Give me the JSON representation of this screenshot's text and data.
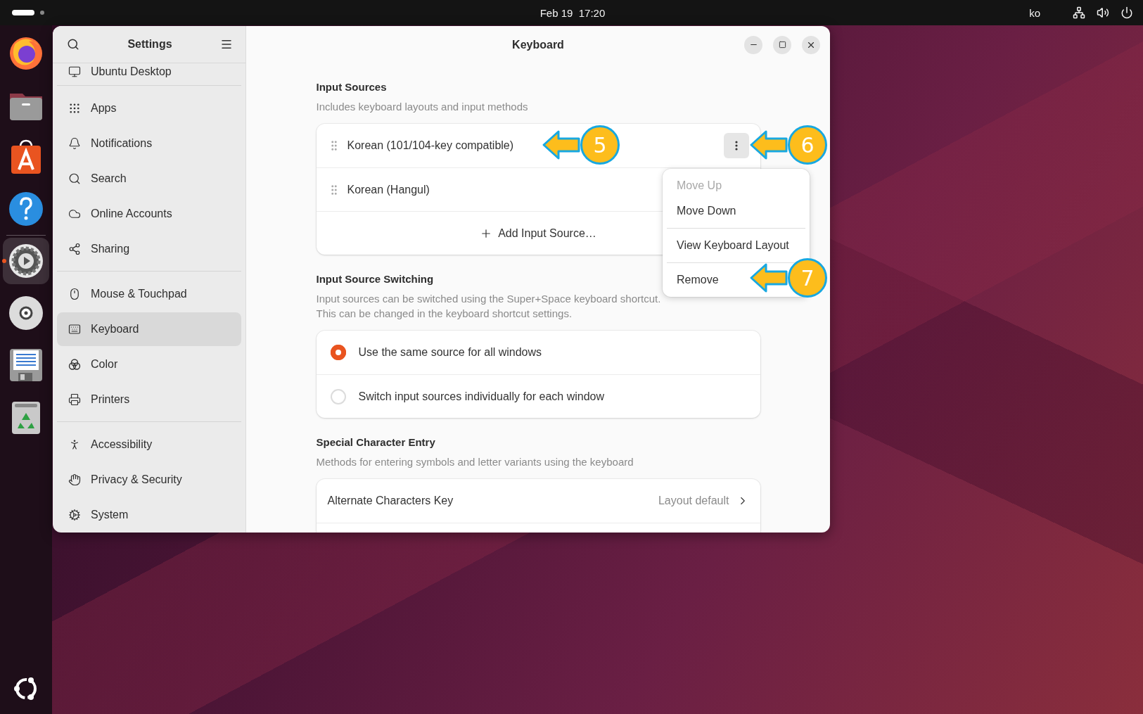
{
  "top_bar": {
    "clock": "Feb 19  17:20",
    "input_method": "ko"
  },
  "dock": {
    "pinned": [
      {
        "kind": "browser",
        "running": false
      },
      {
        "kind": "files",
        "running": false
      },
      {
        "kind": "store",
        "running": false
      },
      {
        "kind": "help",
        "running": false
      }
    ],
    "other": [
      {
        "kind": "settings",
        "running": true
      },
      {
        "kind": "disc",
        "running": false
      },
      {
        "kind": "editor",
        "running": false
      },
      {
        "kind": "trash",
        "running": false
      }
    ]
  },
  "window": {
    "sidebar_title": "Settings",
    "title": "Keyboard"
  },
  "sidebar": {
    "groups": [
      {
        "items": [
          {
            "kind": "desktop",
            "label": "Ubuntu Desktop",
            "selected": false
          }
        ]
      },
      {
        "items": [
          {
            "kind": "apps",
            "label": "Apps",
            "selected": false
          },
          {
            "kind": "notifications",
            "label": "Notifications",
            "selected": false
          },
          {
            "kind": "search",
            "label": "Search",
            "selected": false
          },
          {
            "kind": "accounts",
            "label": "Online Accounts",
            "selected": false
          },
          {
            "kind": "sharing",
            "label": "Sharing",
            "selected": false
          }
        ]
      },
      {
        "items": [
          {
            "kind": "mouse",
            "label": "Mouse & Touchpad",
            "selected": false
          },
          {
            "kind": "keyboard",
            "label": "Keyboard",
            "selected": true
          },
          {
            "kind": "color",
            "label": "Color",
            "selected": false
          },
          {
            "kind": "printers",
            "label": "Printers",
            "selected": false
          }
        ]
      },
      {
        "items": [
          {
            "kind": "accessibility",
            "label": "Accessibility",
            "selected": false
          },
          {
            "kind": "privacy",
            "label": "Privacy & Security",
            "selected": false
          },
          {
            "kind": "system",
            "label": "System",
            "selected": false
          }
        ]
      }
    ]
  },
  "input_sources": {
    "heading": "Input Sources",
    "description": "Includes keyboard layouts and input methods",
    "sources": [
      {
        "label": "Korean (101/104-key compatible)",
        "menu_open": true
      },
      {
        "label": "Korean (Hangul)",
        "menu_open": false
      }
    ],
    "add_label": "Add Input Source…"
  },
  "source_menu": {
    "groups": [
      [
        {
          "label": "Move Up",
          "disabled": true
        },
        {
          "label": "Move Down",
          "disabled": false
        }
      ],
      [
        {
          "label": "View Keyboard Layout",
          "disabled": false
        }
      ],
      [
        {
          "label": "Remove",
          "disabled": false
        }
      ]
    ]
  },
  "switching": {
    "heading": "Input Source Switching",
    "description": "Input sources can be switched using the Super+Space keyboard shortcut.\nThis can be changed in the keyboard shortcut settings.",
    "options": [
      {
        "label": "Use the same source for all windows",
        "selected": true
      },
      {
        "label": "Switch input sources individually for each window",
        "selected": false
      }
    ]
  },
  "special": {
    "heading": "Special Character Entry",
    "description": "Methods for entering symbols and letter variants using the keyboard",
    "rows": [
      {
        "label": "Alternate Characters Key",
        "value": "Layout default"
      }
    ]
  },
  "annotations": [
    {
      "number": "5"
    },
    {
      "number": "6"
    },
    {
      "number": "7"
    }
  ]
}
